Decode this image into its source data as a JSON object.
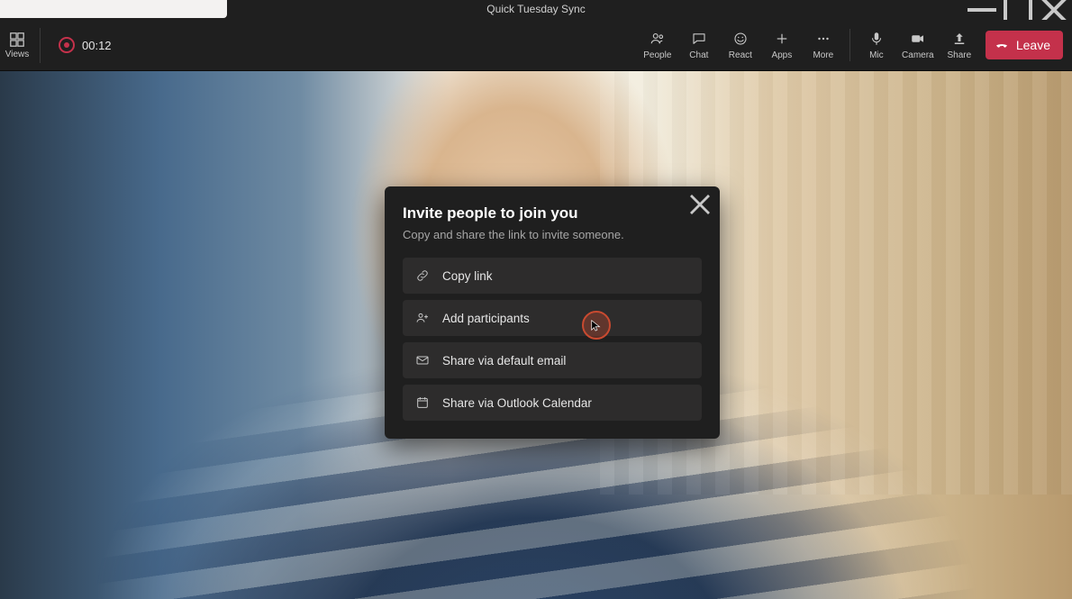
{
  "window": {
    "title": "Quick Tuesday Sync"
  },
  "toolbar": {
    "views_label": "Views",
    "rec_time": "00:12",
    "people": "People",
    "chat": "Chat",
    "react": "React",
    "apps": "Apps",
    "more": "More",
    "mic": "Mic",
    "camera": "Camera",
    "share": "Share",
    "leave": "Leave"
  },
  "modal": {
    "title": "Invite people to join you",
    "subtitle": "Copy and share the link to invite someone.",
    "options": {
      "copy_link": "Copy link",
      "add_participants": "Add participants",
      "share_email": "Share via default email",
      "share_outlook": "Share via Outlook Calendar"
    }
  }
}
